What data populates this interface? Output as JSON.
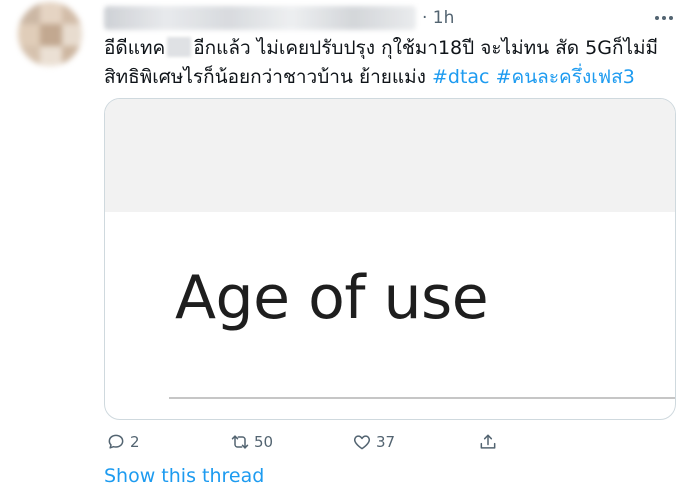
{
  "tweet": {
    "time": "· 1h",
    "text_part1": "อีดีแทค",
    "text_part2": "อีกแล้ว ไม่เคยปรับปรุง กุใช้มา18ปี จะไม่ทน สัด 5Gก็ไม่มี",
    "text_line2": "สิทธิพิเศษไรก็น้อยกว่าชาวบ้าน ย้ายแม่ง ",
    "hashtags": [
      "#dtac",
      "#คนละครึ่งเฟส3"
    ],
    "card_heading": "Age of use",
    "replies": "2",
    "retweets": "50",
    "likes": "37",
    "show_thread": "Show this thread"
  },
  "icons": {
    "reply": "reply-icon",
    "retweet": "retweet-icon",
    "like": "heart-icon",
    "share": "share-icon",
    "more": "more-icon"
  },
  "colors": {
    "link": "#1d9bf0",
    "muted": "#536471",
    "text": "#0f1419"
  }
}
